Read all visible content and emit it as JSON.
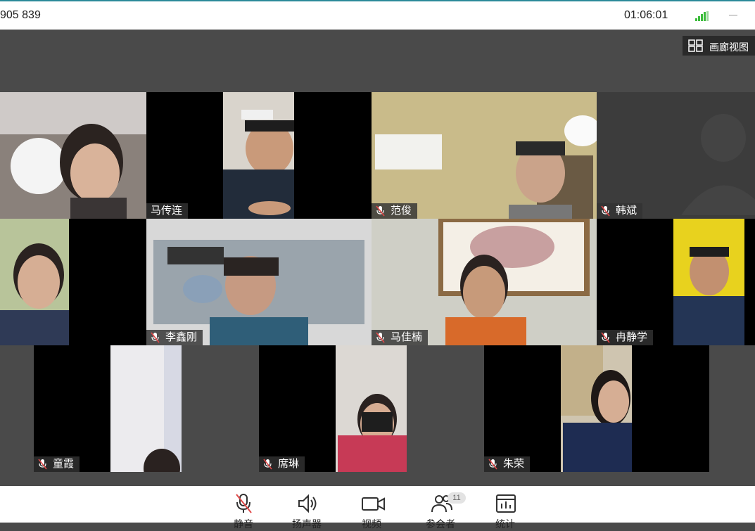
{
  "header": {
    "meeting_id": "905 839",
    "timer": "01:06:01",
    "gallery_view_label": "画廊视图"
  },
  "participants": [
    {
      "name": "马传连",
      "muted": false
    },
    {
      "name": "范俊",
      "muted": true
    },
    {
      "name": "韩斌",
      "muted": true
    },
    {
      "name": "李鑫刚",
      "muted": true
    },
    {
      "name": "马佳楠",
      "muted": true
    },
    {
      "name": "冉静学",
      "muted": true
    },
    {
      "name": "童霞",
      "muted": true
    },
    {
      "name": "席琳",
      "muted": true
    },
    {
      "name": "朱荣",
      "muted": true
    }
  ],
  "toolbar": {
    "mute_label": "静音",
    "speaker_label": "扬声器",
    "video_label": "视频",
    "participants_label": "参会者",
    "participants_count": "11",
    "stats_label": "统计"
  },
  "colors": {
    "background": "#4a4a4a",
    "muted_icon": "#e04848",
    "signal": "#3cbc3c"
  }
}
